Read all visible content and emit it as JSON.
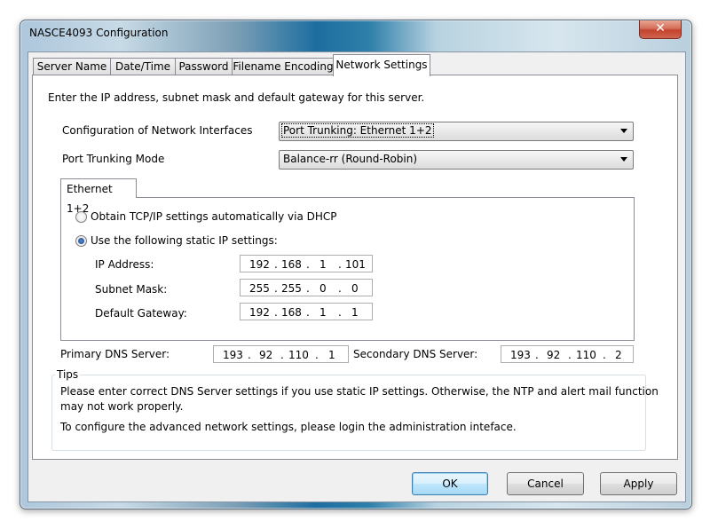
{
  "window": {
    "title": "NASCE4093 Configuration",
    "close_glyph": "✕"
  },
  "tabs": [
    {
      "label": "Server Name"
    },
    {
      "label": "Date/Time"
    },
    {
      "label": "Password"
    },
    {
      "label": "Filename Encoding"
    },
    {
      "label": "Network Settings",
      "active": true
    }
  ],
  "intro": "Enter the IP address, subnet mask and default gateway for this server.",
  "network_interfaces": {
    "label": "Configuration of Network Interfaces",
    "selected": "Port Trunking: Ethernet 1+2"
  },
  "port_trunking": {
    "label": "Port Trunking Mode",
    "selected": "Balance-rr (Round-Robin)"
  },
  "ethernet_group": {
    "tab_label": "Ethernet 1+2",
    "radio_dhcp": {
      "label": "Obtain TCP/IP settings automatically via DHCP",
      "checked": false
    },
    "radio_static": {
      "label": "Use the following static IP settings:",
      "checked": true
    },
    "ip_address": {
      "label": "IP Address:",
      "octets": [
        "192",
        "168",
        "1",
        "101"
      ]
    },
    "subnet_mask": {
      "label": "Subnet Mask:",
      "octets": [
        "255",
        "255",
        "0",
        "0"
      ]
    },
    "default_gateway": {
      "label": "Default Gateway:",
      "octets": [
        "192",
        "168",
        "1",
        "1"
      ]
    }
  },
  "dns": {
    "primary": {
      "label": "Primary DNS Server:",
      "octets": [
        "193",
        "92",
        "110",
        "1"
      ]
    },
    "secondary": {
      "label": "Secondary DNS Server:",
      "octets": [
        "193",
        "92",
        "110",
        "2"
      ]
    }
  },
  "tips": {
    "label": "Tips",
    "line1": "Please enter correct DNS Server settings if you use static IP settings.  Otherwise, the NTP and alert mail function",
    "line2": "may not work properly.",
    "line3": "To configure the advanced network settings, please login the administration inteface."
  },
  "buttons": {
    "ok": "OK",
    "cancel": "Cancel",
    "apply": "Apply"
  },
  "colors": {
    "default_button_border": "#3c7fb1",
    "radio_dot": "#1a3e84",
    "close_button": "#c3422d"
  },
  "icons": {
    "close": "close-icon",
    "dropdown": "chevron-down-icon"
  }
}
